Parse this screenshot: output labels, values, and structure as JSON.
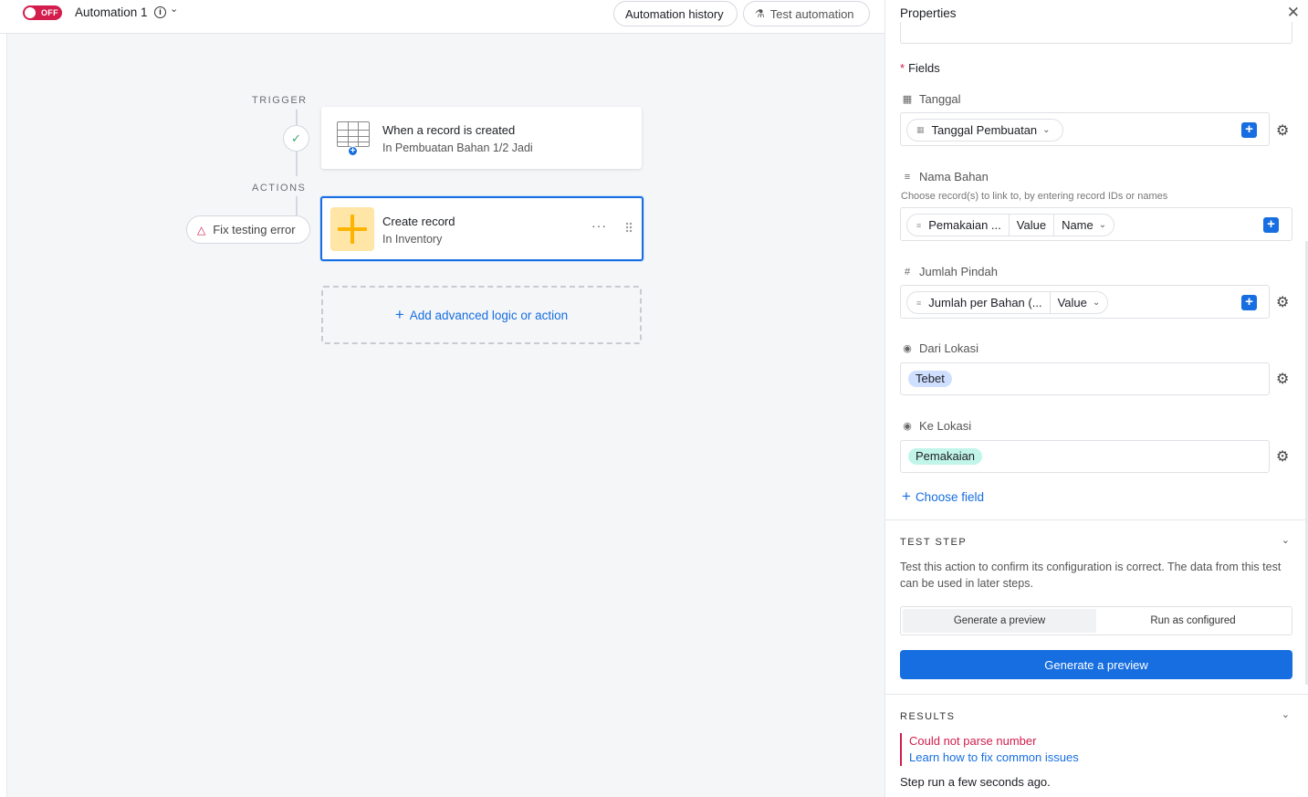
{
  "topbar": {
    "toggle_state": "OFF",
    "automation_name": "Automation 1",
    "history_label": "Automation history",
    "test_label": "Test automation"
  },
  "canvas": {
    "trigger_label": "TRIGGER",
    "actions_label": "ACTIONS",
    "trigger_card": {
      "title": "When a record is created",
      "subtitle": "In Pembuatan Bahan 1/2 Jadi"
    },
    "action_card": {
      "title": "Create record",
      "subtitle": "In Inventory"
    },
    "fix_error_label": "Fix testing error",
    "add_logic_label": "Add advanced logic or action"
  },
  "panel": {
    "title": "Properties",
    "fields_label": "Fields",
    "fields": [
      {
        "label": "Tanggal",
        "icon": "calendar-icon",
        "token": "Tanggal Pembuatan"
      },
      {
        "label": "Nama Bahan",
        "icon": "link-icon",
        "hint": "Choose record(s) to link to, by entering record IDs or names",
        "token": "Pemakaian ...",
        "token_seg2": "Value",
        "token_seg3": "Name"
      },
      {
        "label": "Jumlah Pindah",
        "icon": "hash-icon",
        "token": "Jumlah per Bahan (...",
        "token_seg2": "Value"
      },
      {
        "label": "Dari Lokasi",
        "icon": "select-icon",
        "chip": "Tebet"
      },
      {
        "label": "Ke Lokasi",
        "icon": "select-icon",
        "chip": "Pemakaian"
      }
    ],
    "choose_field_label": "Choose field",
    "test_step": {
      "title": "TEST STEP",
      "description": "Test this action to confirm its configuration is correct. The data from this test can be used in later steps.",
      "option_preview": "Generate a preview",
      "option_run": "Run as configured",
      "button_label": "Generate a preview"
    },
    "results": {
      "title": "RESULTS",
      "error": "Could not parse number",
      "link": "Learn how to fix common issues",
      "step_run": "Step run a few seconds ago."
    }
  },
  "colors": {
    "accent": "#166ee1",
    "error": "#d21d4d",
    "toggle_off": "#d21d4d",
    "chip_blue": "#cfdfff",
    "chip_teal": "#c2f5e9",
    "action_icon": "#fcb400"
  }
}
